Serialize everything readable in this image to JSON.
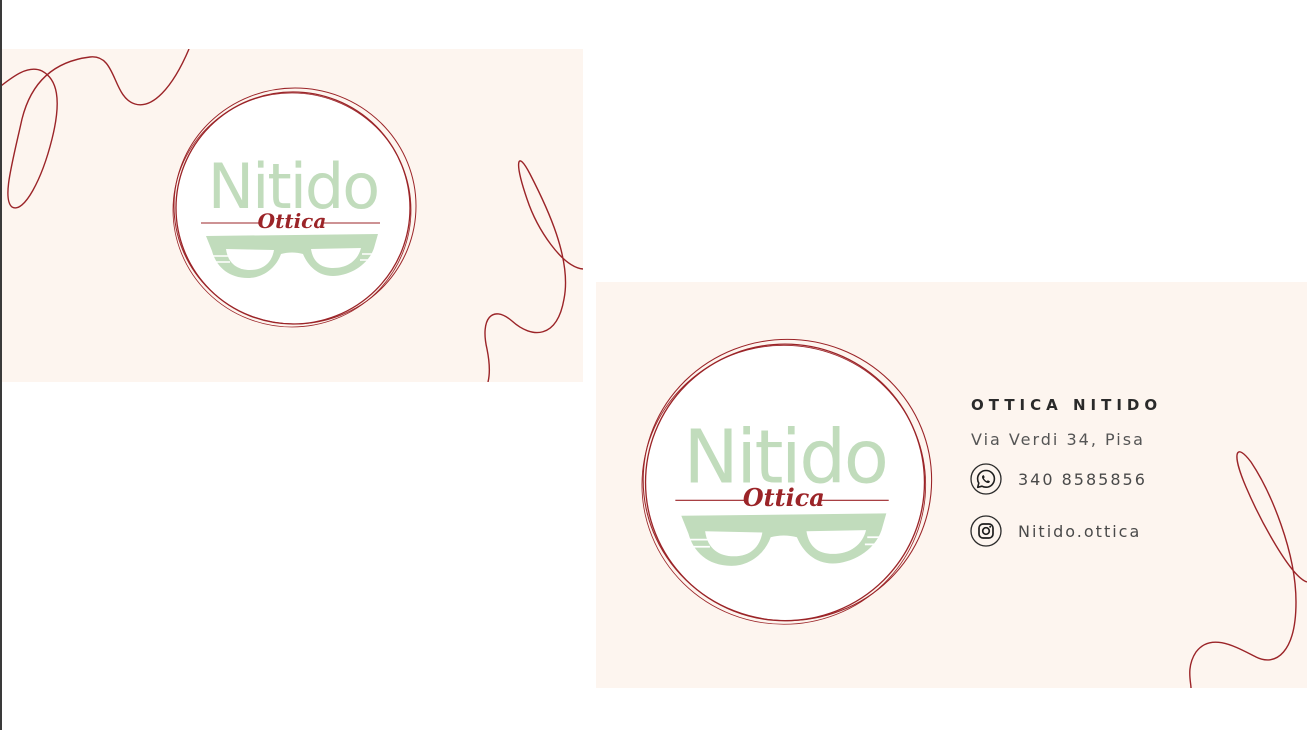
{
  "front": {
    "logo_name": "Nitido",
    "logo_sub": "Ottica"
  },
  "back": {
    "logo_name": "Nitido",
    "logo_sub": "Ottica",
    "shop_name": "OTTICA NITIDO",
    "address": "Via Verdi 34, Pisa",
    "phone": "340 8585856",
    "instagram": "Nitido.ottica",
    "phone_icon": "whatsapp-icon",
    "instagram_icon": "instagram-icon"
  },
  "colors": {
    "card_background": "#fdf5ef",
    "accent_red": "#9b2428",
    "logo_green": "#c1dcbc"
  }
}
